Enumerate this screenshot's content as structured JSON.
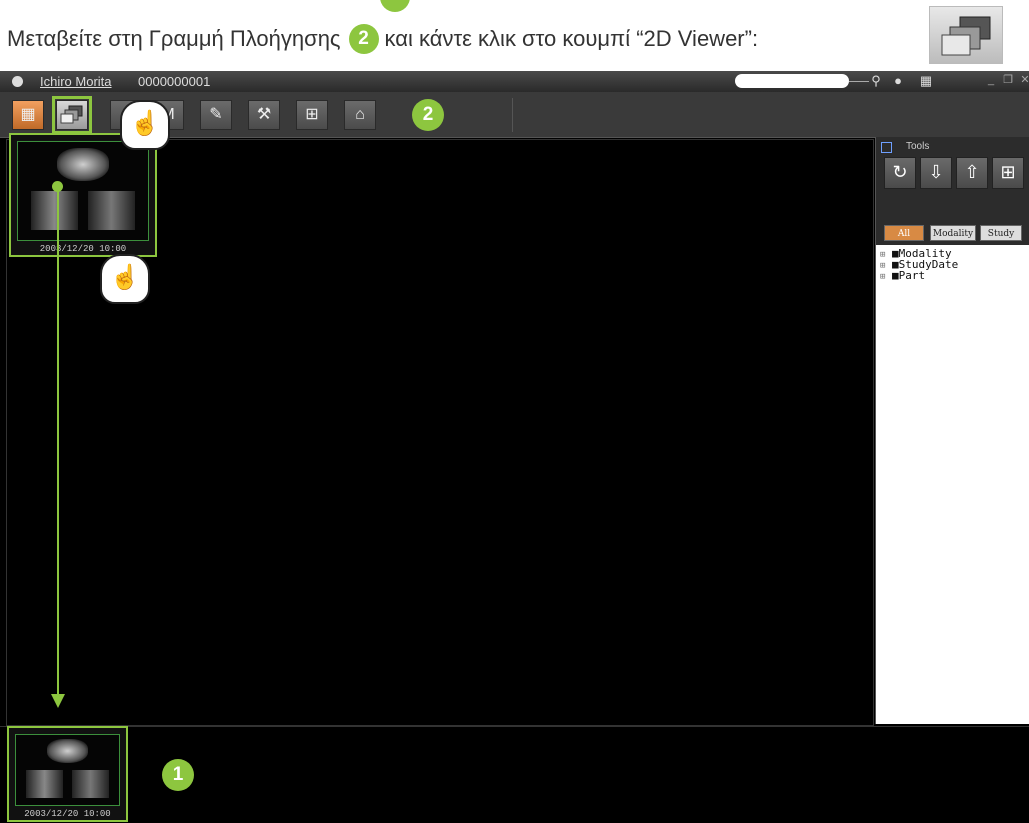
{
  "instruction": {
    "before": "Μεταβείτε στη Γραμμή Πλοήγησης",
    "badge": "2",
    "after": "και κάντε κλικ στο κουμπί “2D Viewer”:"
  },
  "titlebar": {
    "patient_name": "Ichiro Morita",
    "patient_id": "0000000001"
  },
  "toolbar": {
    "buttons": [
      {
        "icon": "grid-icon",
        "active": true
      },
      {
        "icon": "2d-viewer-icon",
        "highlighted": true
      },
      {
        "icon": "3d-icon"
      },
      {
        "icon": "dicom-icon",
        "label": "M"
      },
      {
        "icon": "edit-notes-icon"
      },
      {
        "icon": "wrench-icon"
      },
      {
        "icon": "layout-icon"
      },
      {
        "icon": "home-icon"
      }
    ],
    "badge": "2"
  },
  "thumbnail": {
    "date": "2003/12/20 10:00"
  },
  "tools": {
    "title": "Tools",
    "filters": [
      "All",
      "Modality",
      "Study"
    ],
    "tree": [
      "■Modality",
      "■StudyDate",
      "■Part"
    ]
  },
  "bottom_thumbnail": {
    "date": "2003/12/20 10:00"
  },
  "bottom_badge": "1",
  "colors": {
    "accent": "#8dc63f",
    "active_tab": "#d88a44",
    "background": "#000000"
  }
}
